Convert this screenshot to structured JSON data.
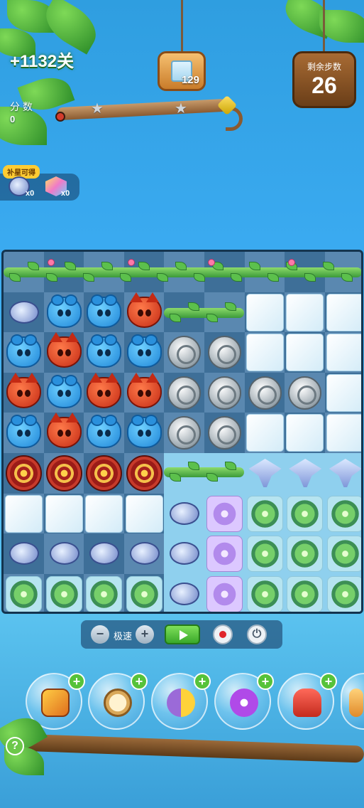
{
  "hud": {
    "level": "+1132关",
    "target_count": "129",
    "moves_label": "剩余步数",
    "moves_value": "26",
    "score_label": "分 数",
    "score_value": "0"
  },
  "boosters_panel": {
    "tag": "补星可得",
    "items": [
      {
        "icon": "fish-booster-icon",
        "count": "x0"
      },
      {
        "icon": "hexagon-gem-icon",
        "count": "x0"
      }
    ]
  },
  "board": {
    "cols": 9,
    "rows": 9,
    "grid": [
      [
        "vine",
        "vine",
        "vine",
        "vine",
        "vine",
        "vine",
        "vine",
        "vine",
        "vine"
      ],
      [
        "fish",
        "bear",
        "bear",
        "fox",
        "vine-seg",
        "vine-seg",
        "ice",
        "ice",
        "ice"
      ],
      [
        "bear",
        "fox",
        "bear",
        "bear",
        "coin",
        "coin",
        "ice",
        "ice",
        "ice"
      ],
      [
        "fox",
        "bear",
        "fox",
        "fox",
        "coin",
        "coin",
        "coin",
        "coin",
        "ice"
      ],
      [
        "bear",
        "fox",
        "bear",
        "bear",
        "coin",
        "coin",
        "ice",
        "ice",
        "ice"
      ],
      [
        "target",
        "target",
        "target",
        "target",
        "vine-seg",
        "vine-seg",
        "ray",
        "ray",
        "ray"
      ],
      [
        "ice",
        "ice",
        "ice",
        "ice",
        "fish",
        "purple",
        "flower",
        "flower",
        "flower"
      ],
      [
        "fish",
        "fish",
        "fish",
        "fish",
        "fish",
        "purple",
        "flower",
        "flower",
        "flower"
      ],
      [
        "flower",
        "flower",
        "flower",
        "flower",
        "fish",
        "purple",
        "flower",
        "flower",
        "flower"
      ]
    ]
  },
  "controls": {
    "minus": "−",
    "speed_label": "极速",
    "plus": "+",
    "power": "⏻"
  },
  "bubbles": [
    {
      "icon": "shuffle-board-icon",
      "plus": "+"
    },
    {
      "icon": "clock-icon",
      "plus": "+"
    },
    {
      "icon": "swap-creatures-icon",
      "plus": "+"
    },
    {
      "icon": "purple-rocket-icon",
      "plus": "+"
    },
    {
      "icon": "red-rocket-icon",
      "plus": "+"
    },
    {
      "icon": "more-booster-icon",
      "plus": "+"
    }
  ],
  "help_label": "?"
}
